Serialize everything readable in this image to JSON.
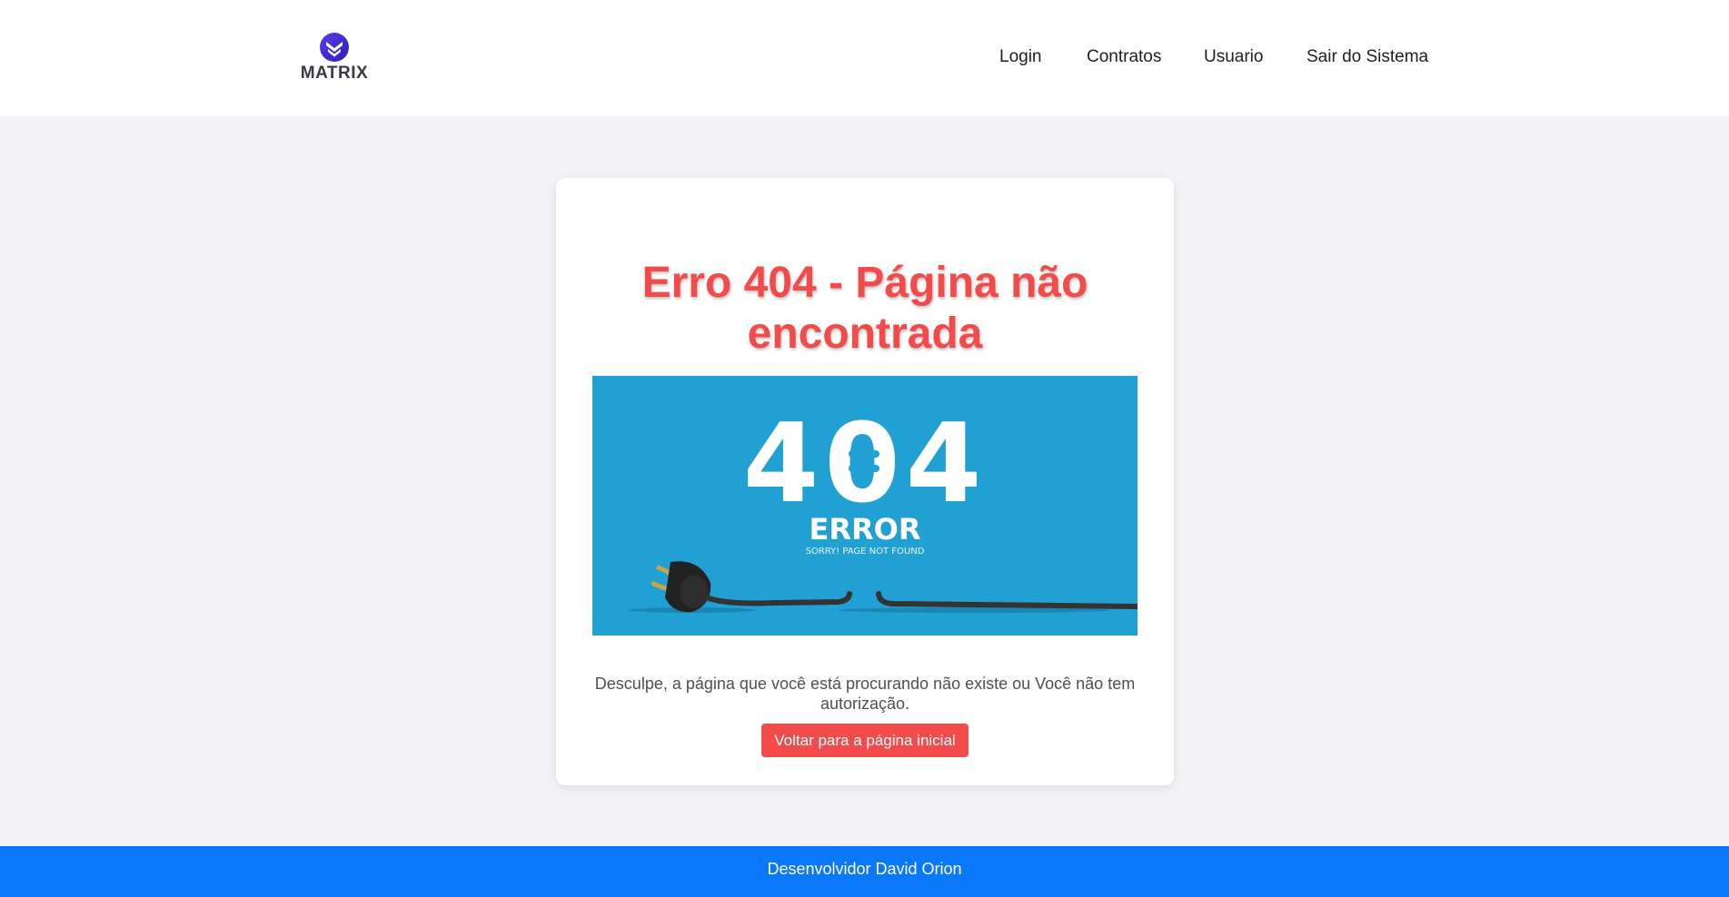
{
  "header": {
    "logo_text": "MATRIX",
    "nav": {
      "login": "Login",
      "contratos": "Contratos",
      "usuario": "Usuario",
      "sair": "Sair do Sistema"
    }
  },
  "main": {
    "title": "Erro 404 - Página não encontrada",
    "image": {
      "big_code": "404",
      "error_word": "ERROR",
      "error_subtext": "SORRY! PAGE NOT FOUND"
    },
    "message": "Desculpe, a página que você está procurando não existe ou Você não tem autorização.",
    "back_button": "Voltar para a página inicial"
  },
  "footer": {
    "text": "Desenvolvidor David Orion"
  },
  "colors": {
    "accent_red": "#f24b4b",
    "footer_blue": "#0a78fa",
    "image_blue": "#21a0d4",
    "logo_purple": "#3b2bd6"
  },
  "icons": {
    "logo": "matrix-chevron-logo",
    "plug": "unplugged-plug-icon"
  }
}
